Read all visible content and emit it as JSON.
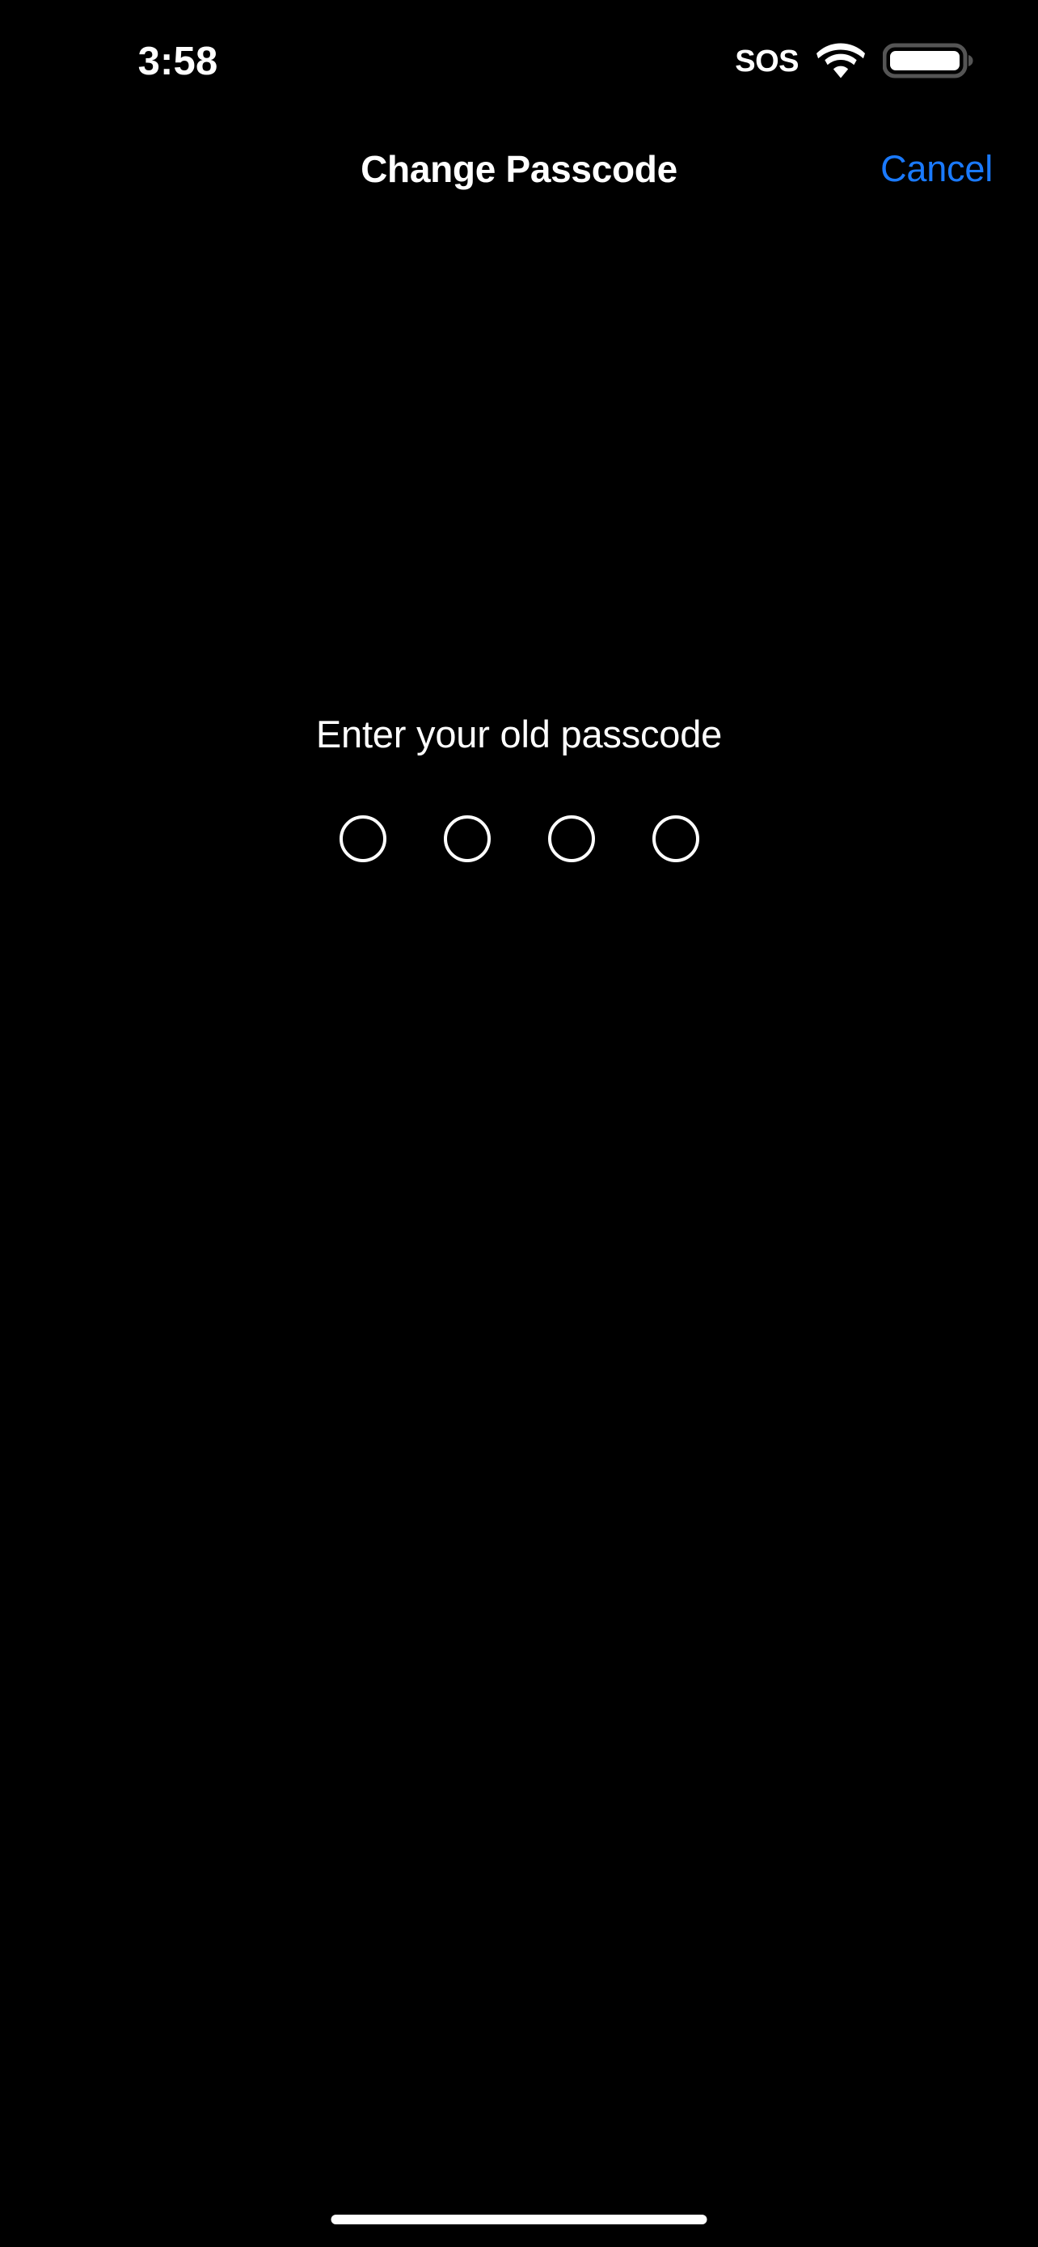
{
  "theme": {
    "background": "#000000",
    "foreground": "#ffffff",
    "accent_blue": "#1a7aff",
    "battery_outline": "#555555"
  },
  "status_bar": {
    "time": "3:58",
    "sos_label": "SOS",
    "wifi_icon": "wifi-icon",
    "wifi_bars": 3,
    "battery_icon": "battery-icon",
    "battery_level_percent": 92
  },
  "nav_bar": {
    "title": "Change Passcode",
    "cancel_label": "Cancel"
  },
  "passcode": {
    "prompt": "Enter your old passcode",
    "digit_count": 4,
    "entered_count": 0,
    "dots": [
      {
        "filled": false
      },
      {
        "filled": false
      },
      {
        "filled": false
      },
      {
        "filled": false
      }
    ]
  },
  "home_indicator": {
    "visible": true
  }
}
